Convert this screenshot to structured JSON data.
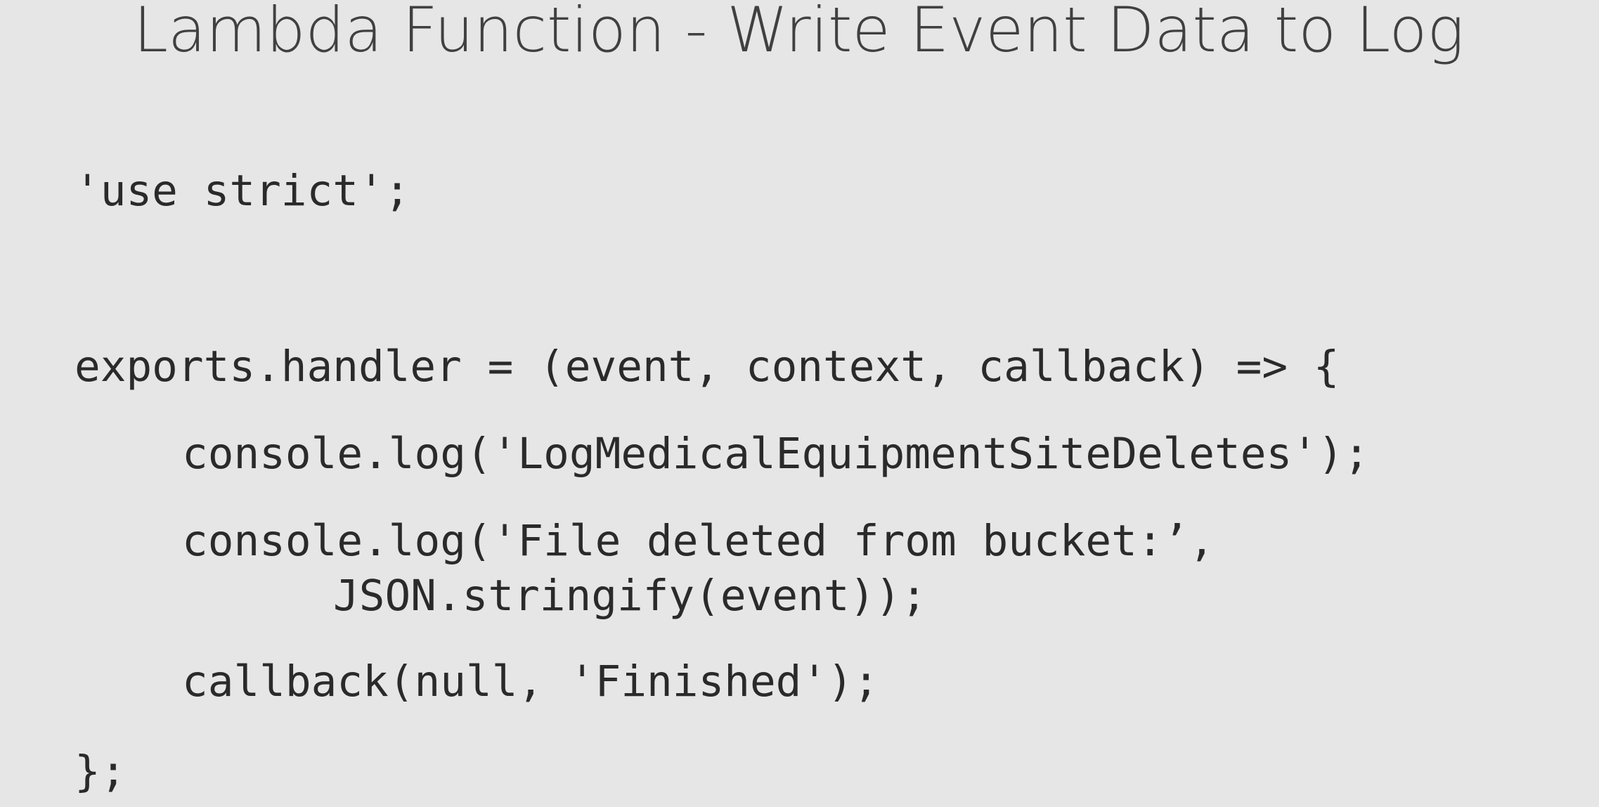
{
  "slide": {
    "title": "Lambda Function - Write Event Data to Log",
    "code_lines": [
      "'use strict';",
      "exports.handler = (event, context, callback) => {",
      "console.log('LogMedicalEquipmentSiteDeletes');",
      "console.log('File deleted from bucket:’,",
      "JSON.stringify(event));",
      "callback(null, 'Finished');",
      "};"
    ]
  }
}
